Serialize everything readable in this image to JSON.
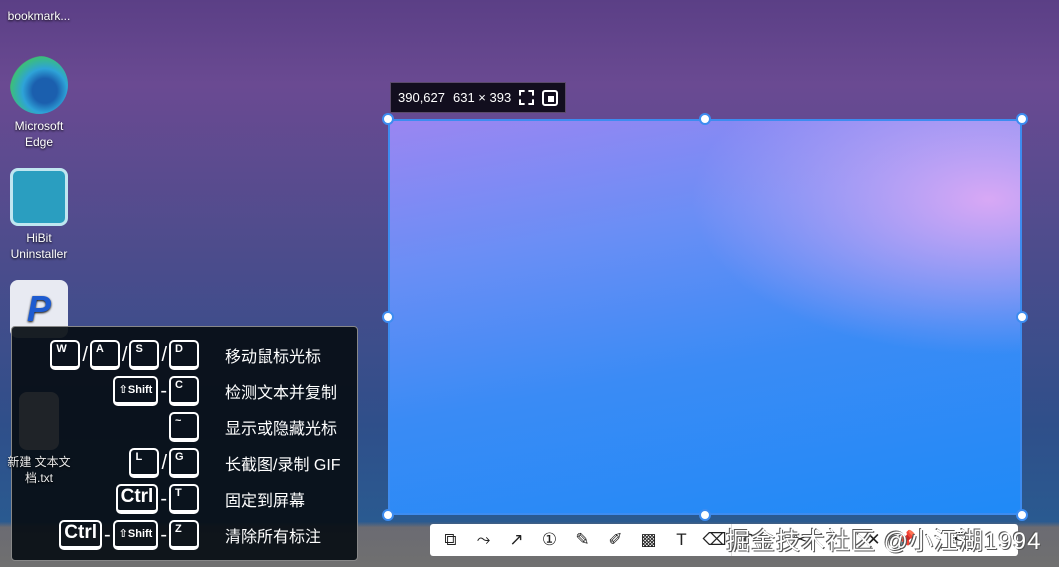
{
  "desktop": {
    "icons": [
      {
        "label": "bookmark..."
      },
      {
        "label": "Microsoft Edge"
      },
      {
        "label": "HiBit Uninstaller"
      },
      {
        "label": "新建 文本文档.txt"
      }
    ]
  },
  "selection": {
    "position": "390,627",
    "size": "631 × 393"
  },
  "shortcuts": [
    {
      "keys": [
        "W",
        "A",
        "S",
        "D"
      ],
      "sep": "/",
      "desc": "移动鼠标光标"
    },
    {
      "keys": [
        "⇧Shift",
        "C"
      ],
      "sep": "-",
      "desc": "检测文本并复制"
    },
    {
      "keys": [
        "~"
      ],
      "sep": "",
      "desc": "显示或隐藏光标"
    },
    {
      "keys": [
        "L",
        "G"
      ],
      "sep": "/",
      "desc": "长截图/录制 GIF"
    },
    {
      "keys": [
        "Ctrl",
        "T"
      ],
      "sep": "-",
      "desc": "固定到屏幕"
    },
    {
      "keys": [
        "Ctrl",
        "⇧Shift",
        "Z"
      ],
      "sep": "-",
      "desc": "清除所有标注"
    }
  ],
  "toolbar": {
    "tools": [
      "shape",
      "polyline",
      "arrow",
      "number",
      "pen",
      "highlighter",
      "mosaic",
      "text",
      "eraser",
      "undo",
      "scissors",
      "close",
      "pin",
      "save"
    ]
  },
  "watermark": "掘金技术社区 @小江湖1994",
  "colors": {
    "accent": "#3d8cf0"
  }
}
